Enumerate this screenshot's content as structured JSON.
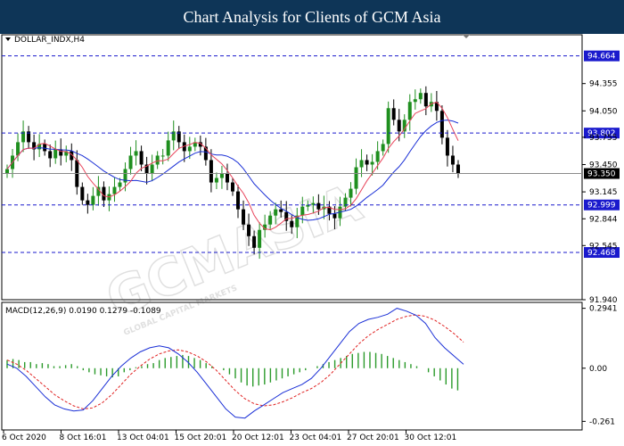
{
  "title": "Chart Analysis for Clients of GCM Asia",
  "watermark": {
    "main": "GCMASIA",
    "sub": "GLOBAL CAPITAL MARKETS"
  },
  "colors": {
    "title_bg": "#0e3557",
    "bull": "#1f8f1f",
    "bear": "#000000",
    "ma_fast": "#e8435a",
    "ma_slow": "#1a2fd6",
    "level": "#1a1acd",
    "macd_line": "#1a2fd6",
    "signal_line": "#e02020",
    "hist": "#2a9a2a",
    "current_badge": "#000000",
    "level_badge": "#1a1acd"
  },
  "chart_data": [
    {
      "type": "candlestick",
      "symbol_label": "DOLLAR_INDX,H4",
      "ylim": [
        91.94,
        94.9
      ],
      "y_ticks": [
        "94.355",
        "94.050",
        "93.755",
        "93.450",
        "93.145",
        "92.844",
        "92.545",
        "91.940"
      ],
      "x_ticks": [
        "6 Oct 2020",
        "8 Oct 16:01",
        "13 Oct 04:01",
        "15 Oct 20:01",
        "20 Oct 12:01",
        "23 Oct 04:01",
        "27 Oct 20:01",
        "30 Oct 12:01"
      ],
      "levels": [
        "94.664",
        "93.802",
        "92.999",
        "92.468"
      ],
      "current_price": "93.350",
      "close": [
        93.4,
        93.55,
        93.7,
        93.82,
        93.7,
        93.62,
        93.68,
        93.6,
        93.52,
        93.62,
        93.55,
        93.6,
        93.5,
        93.2,
        93.05,
        93.0,
        93.1,
        93.2,
        93.05,
        93.12,
        93.2,
        93.25,
        93.4,
        93.55,
        93.6,
        93.45,
        93.35,
        93.45,
        93.55,
        93.55,
        93.72,
        93.82,
        93.7,
        93.6,
        93.65,
        93.7,
        93.65,
        93.5,
        93.25,
        93.3,
        93.35,
        93.25,
        93.15,
        92.95,
        92.78,
        92.65,
        92.52,
        92.72,
        92.78,
        92.88,
        92.95,
        92.92,
        92.82,
        92.75,
        92.88,
        92.98,
        93.0,
        93.02,
        92.95,
        92.98,
        92.9,
        92.85,
        92.98,
        93.08,
        93.18,
        93.42,
        93.5,
        93.45,
        93.48,
        93.6,
        93.68,
        94.08,
        93.95,
        93.82,
        93.95,
        94.15,
        94.18,
        94.25,
        94.1,
        94.15,
        94.05,
        93.75,
        93.55,
        93.45,
        93.35
      ]
    },
    {
      "type": "macd",
      "label": "MACD(12,26,9) 0.0190 0.1279 -0.1089",
      "ylim": [
        -0.29,
        0.31
      ],
      "y_ticks": [
        "0.2941",
        "0.00",
        "-0.261"
      ],
      "macd": [
        0.02,
        0.0,
        -0.04,
        -0.09,
        -0.14,
        -0.18,
        -0.2,
        -0.21,
        -0.205,
        -0.16,
        -0.1,
        -0.04,
        0.01,
        0.05,
        0.08,
        0.1,
        0.11,
        0.1,
        0.07,
        0.03,
        -0.02,
        -0.08,
        -0.14,
        -0.2,
        -0.24,
        -0.245,
        -0.21,
        -0.18,
        -0.15,
        -0.12,
        -0.1,
        -0.08,
        -0.05,
        0.0,
        0.06,
        0.12,
        0.18,
        0.22,
        0.24,
        0.25,
        0.265,
        0.2941,
        0.28,
        0.26,
        0.22,
        0.15,
        0.1,
        0.06,
        0.019
      ],
      "signal": [
        0.04,
        0.02,
        -0.01,
        -0.05,
        -0.09,
        -0.13,
        -0.16,
        -0.185,
        -0.2,
        -0.195,
        -0.17,
        -0.13,
        -0.08,
        -0.03,
        0.01,
        0.045,
        0.07,
        0.085,
        0.09,
        0.08,
        0.06,
        0.03,
        -0.01,
        -0.06,
        -0.11,
        -0.15,
        -0.175,
        -0.185,
        -0.18,
        -0.165,
        -0.145,
        -0.12,
        -0.1,
        -0.07,
        -0.03,
        0.02,
        0.07,
        0.12,
        0.16,
        0.19,
        0.215,
        0.24,
        0.255,
        0.262,
        0.255,
        0.235,
        0.205,
        0.17,
        0.1279
      ],
      "histogram": [
        0.04,
        0.045,
        0.04,
        0.03,
        0.03,
        0.02,
        0.025,
        0.02,
        0.01,
        0.01,
        0.015,
        0.02,
        0.01,
        -0.01,
        -0.02,
        -0.03,
        -0.035,
        -0.04,
        -0.045,
        -0.04,
        -0.02,
        -0.01,
        0.005,
        0.01,
        0.02,
        0.025,
        0.04,
        0.05,
        0.055,
        0.06,
        0.065,
        0.06,
        0.05,
        0.04,
        0.025,
        0.01,
        0.0,
        -0.01,
        -0.03,
        -0.05,
        -0.07,
        -0.085,
        -0.09,
        -0.085,
        -0.08,
        -0.07,
        -0.06,
        -0.05,
        -0.04,
        -0.03,
        -0.02,
        -0.01,
        0.0,
        0.01,
        0.02,
        0.03,
        0.04,
        0.05,
        0.06,
        0.07,
        0.075,
        0.08,
        0.08,
        0.075,
        0.07,
        0.06,
        0.05,
        0.04,
        0.03,
        0.02,
        0.01,
        0.0,
        -0.02,
        -0.04,
        -0.06,
        -0.08,
        -0.1,
        -0.1089
      ]
    }
  ]
}
